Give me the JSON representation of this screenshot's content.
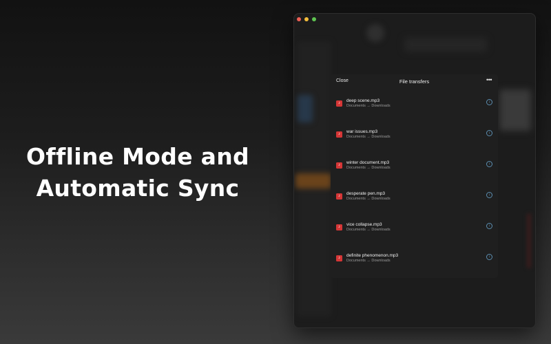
{
  "hero": {
    "line1": "Offline Mode and",
    "line2": "Automatic Sync"
  },
  "window": {
    "traffic_lights": [
      "close",
      "minimize",
      "zoom"
    ]
  },
  "panel": {
    "close_label": "Close",
    "title": "File transfers",
    "more_label": "•••",
    "file_icon_glyph": "♪",
    "download_icon_glyph": "↓",
    "files": [
      {
        "name": "deep scene.mp3",
        "path": "Documents → Downloads"
      },
      {
        "name": "war issues.mp3",
        "path": "Documents → Downloads"
      },
      {
        "name": "winter document.mp3",
        "path": "Documents → Downloads"
      },
      {
        "name": "desperate pen.mp3",
        "path": "Documents → Downloads"
      },
      {
        "name": "vice collapse.mp3",
        "path": "Documents → Downloads"
      },
      {
        "name": "definite phenomenon.mp3",
        "path": "Documents → Downloads"
      }
    ]
  },
  "colors": {
    "file_icon": "#d53636",
    "download_icon": "#5b8db0",
    "accent_orange": "#c8782a"
  }
}
